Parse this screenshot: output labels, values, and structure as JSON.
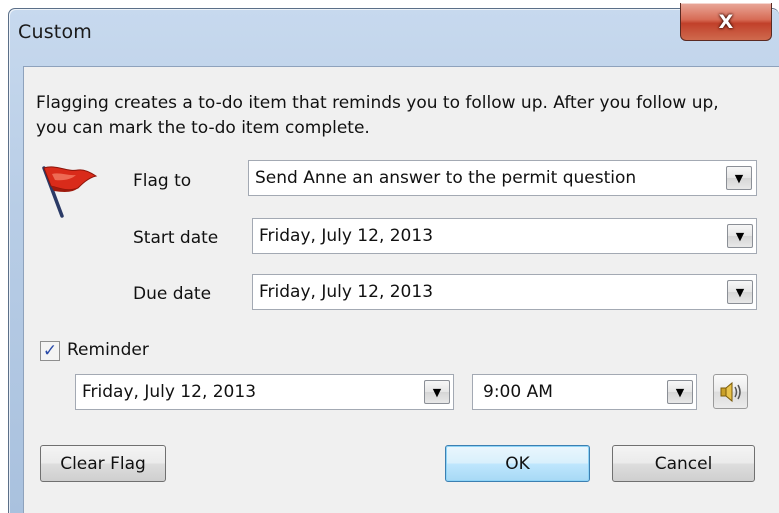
{
  "window": {
    "title": "Custom",
    "close_glyph": "X"
  },
  "description": "Flagging creates a to-do item that reminds you to follow up. After you follow up, you can mark the to-do item complete.",
  "flag_to": {
    "label": "Flag to",
    "value": "Send Anne an answer to the permit question"
  },
  "start_date": {
    "label": "Start date",
    "value": "Friday, July 12, 2013"
  },
  "due_date": {
    "label": "Due date",
    "value": "Friday, July 12, 2013"
  },
  "reminder": {
    "label": "Reminder",
    "checked": true,
    "date": "Friday, July 12, 2013",
    "time": "9:00 AM"
  },
  "buttons": {
    "clear_flag": "Clear Flag",
    "ok": "OK",
    "cancel": "Cancel"
  },
  "icons": {
    "flag": "red-flag-icon",
    "dropdown": "chevron-down-icon",
    "sound": "speaker-icon",
    "check": "checkmark-icon"
  },
  "colors": {
    "flag_red": "#d92b1a",
    "close_red": "#c1402a",
    "default_button": "#bee6fd",
    "dialog_bg": "#f0f0f0"
  }
}
